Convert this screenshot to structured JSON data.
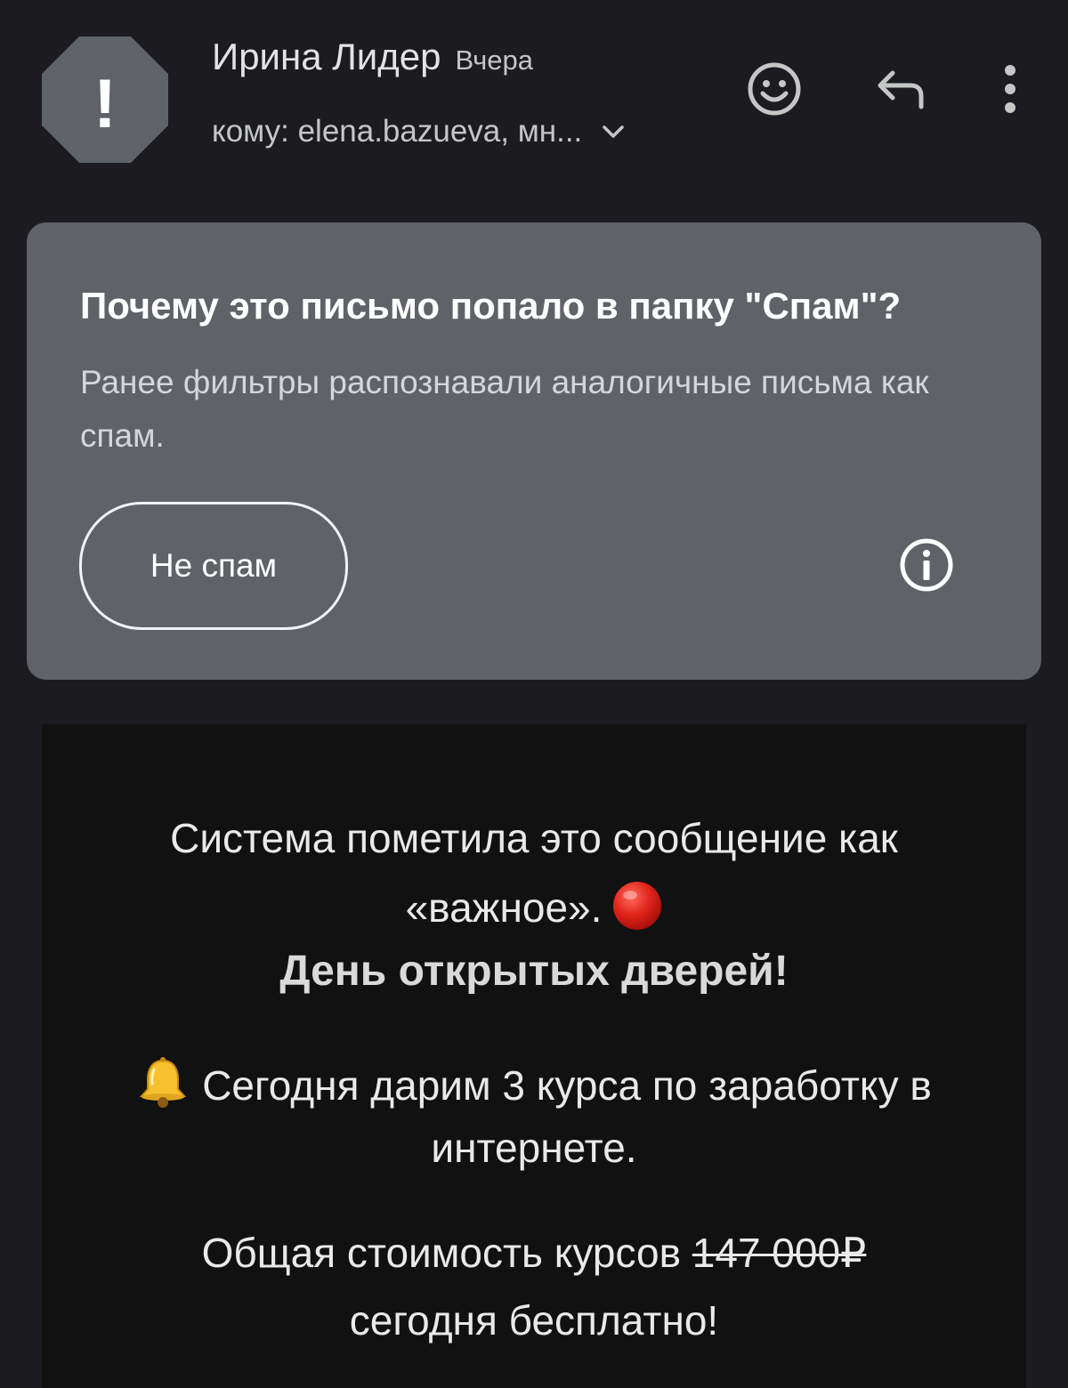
{
  "header": {
    "avatar_symbol": "!",
    "sender_name": "Ирина Лидер",
    "date": "Вчера",
    "recipients": "кому: elena.bazueva, мн...",
    "icons": {
      "avatar": "spam-warning-octagon-icon",
      "expand": "chevron-down-icon",
      "emoji": "add-reaction-icon",
      "reply": "reply-icon",
      "more": "more-vert-icon"
    }
  },
  "spam_notice": {
    "title": "Почему это письмо попало в папку \"Спам\"?",
    "description": "Ранее фильтры распознавали аналогичные письма как спам.",
    "not_spam_label": "Не спам",
    "info_icon": "info-icon"
  },
  "email": {
    "line1": "Система пометила это сообщение как",
    "line2": "«важное».",
    "headline": "День открытых дверей!",
    "offer_line1": "Сегодня дарим 3 курса по заработку в",
    "offer_line2": "интернете.",
    "price_prefix": "Общая стоимость курсов ",
    "old_price": "147 000₽",
    "price_suffix": "сегодня бесплатно!",
    "emoji": {
      "red_circle": "red-circle-icon",
      "bell": "bell-icon"
    }
  },
  "colors": {
    "background": "#1b1b20",
    "card": "#5f6368",
    "email_body": "#111111",
    "avatar": "#5f6368"
  }
}
